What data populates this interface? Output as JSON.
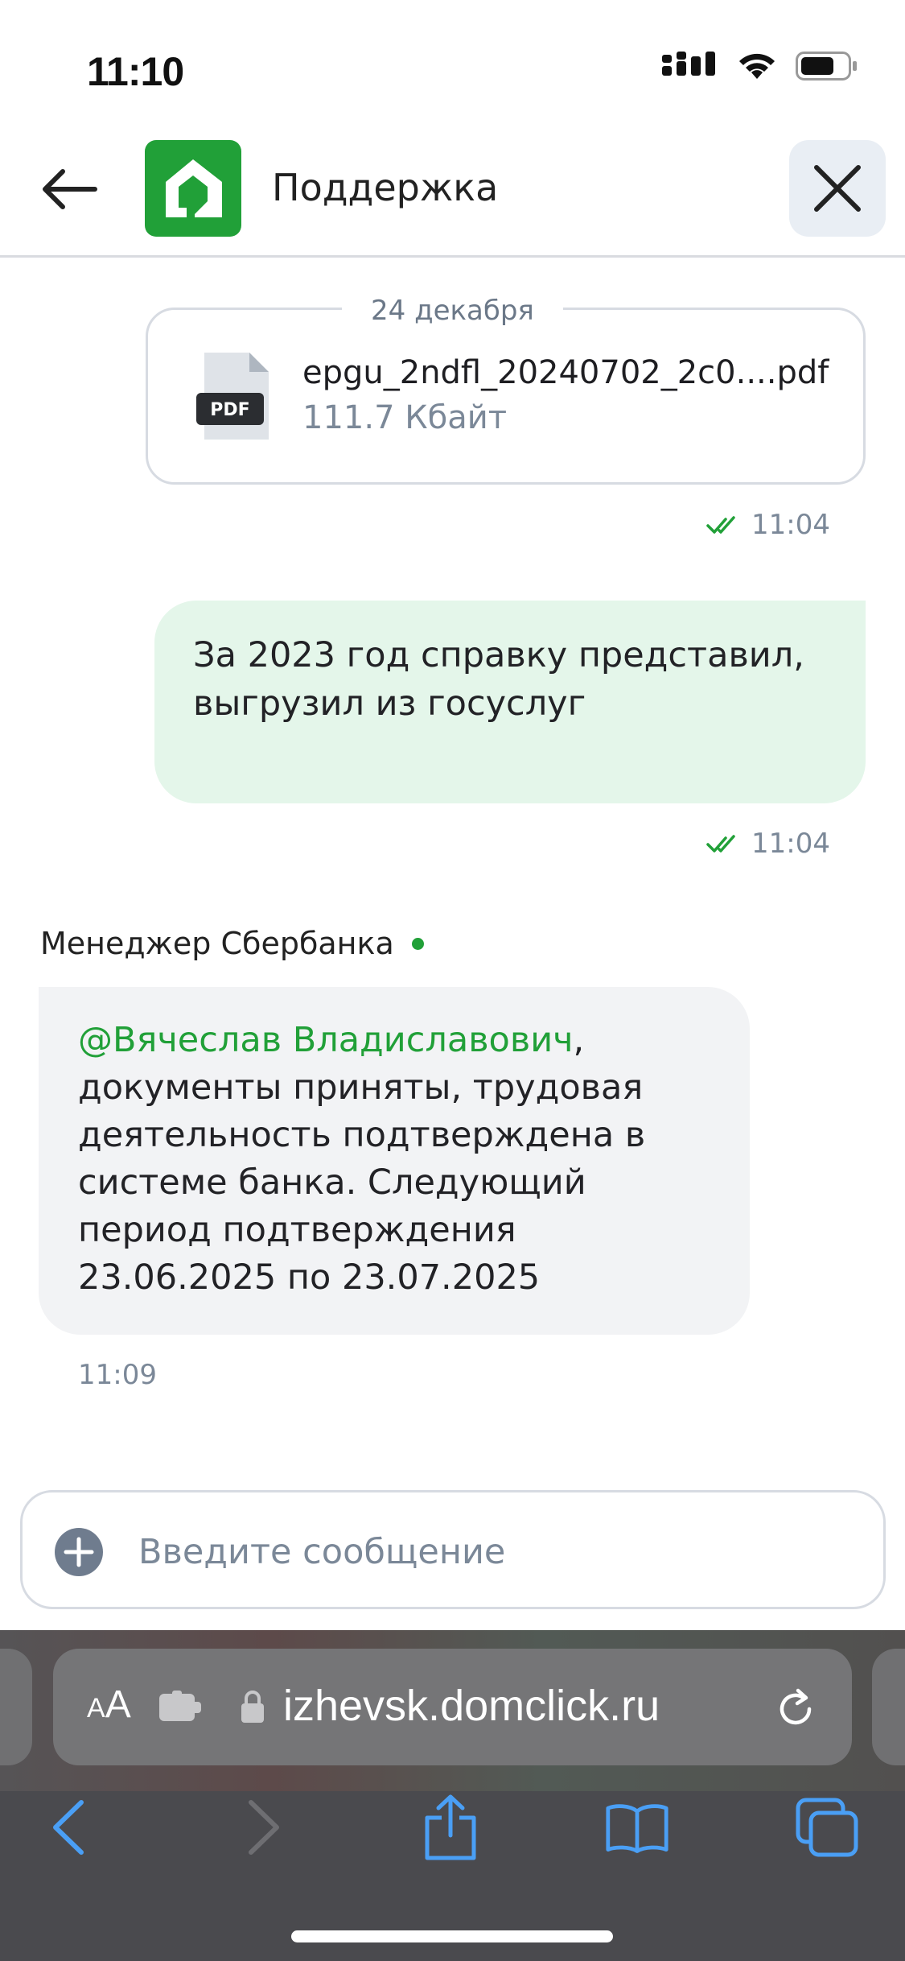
{
  "status_bar": {
    "time": "11:10"
  },
  "header": {
    "title": "Поддержка"
  },
  "messages": {
    "file": {
      "date": "24 декабря",
      "badge": "PDF",
      "name": "epgu_2ndfl_20240702_2c0....pdf",
      "size": "111.7 Кбайт",
      "time": "11:04"
    },
    "outgoing": {
      "text": "За 2023 год справку представил, выгрузил из госуслуг",
      "time": "11:04"
    },
    "incoming": {
      "sender": "Менеджер Сбербанка",
      "mention": "@Вячеслав Владиславович",
      "text": ", документы приняты, трудовая деятельность подтверждена в системе банка. Следующий период подтверждения 23.06.2025 по 23.07.2025",
      "time": "11:09"
    }
  },
  "composer": {
    "placeholder": "Введите сообщение"
  },
  "browser": {
    "aa_small": "A",
    "aa_large": "A",
    "url": "izhevsk.domclick.ru"
  },
  "colors": {
    "accent": "#21a038",
    "outgoing_bubble": "#e4f6ea",
    "incoming_bubble": "#f2f3f5",
    "safari_link": "#4a9ff5"
  }
}
